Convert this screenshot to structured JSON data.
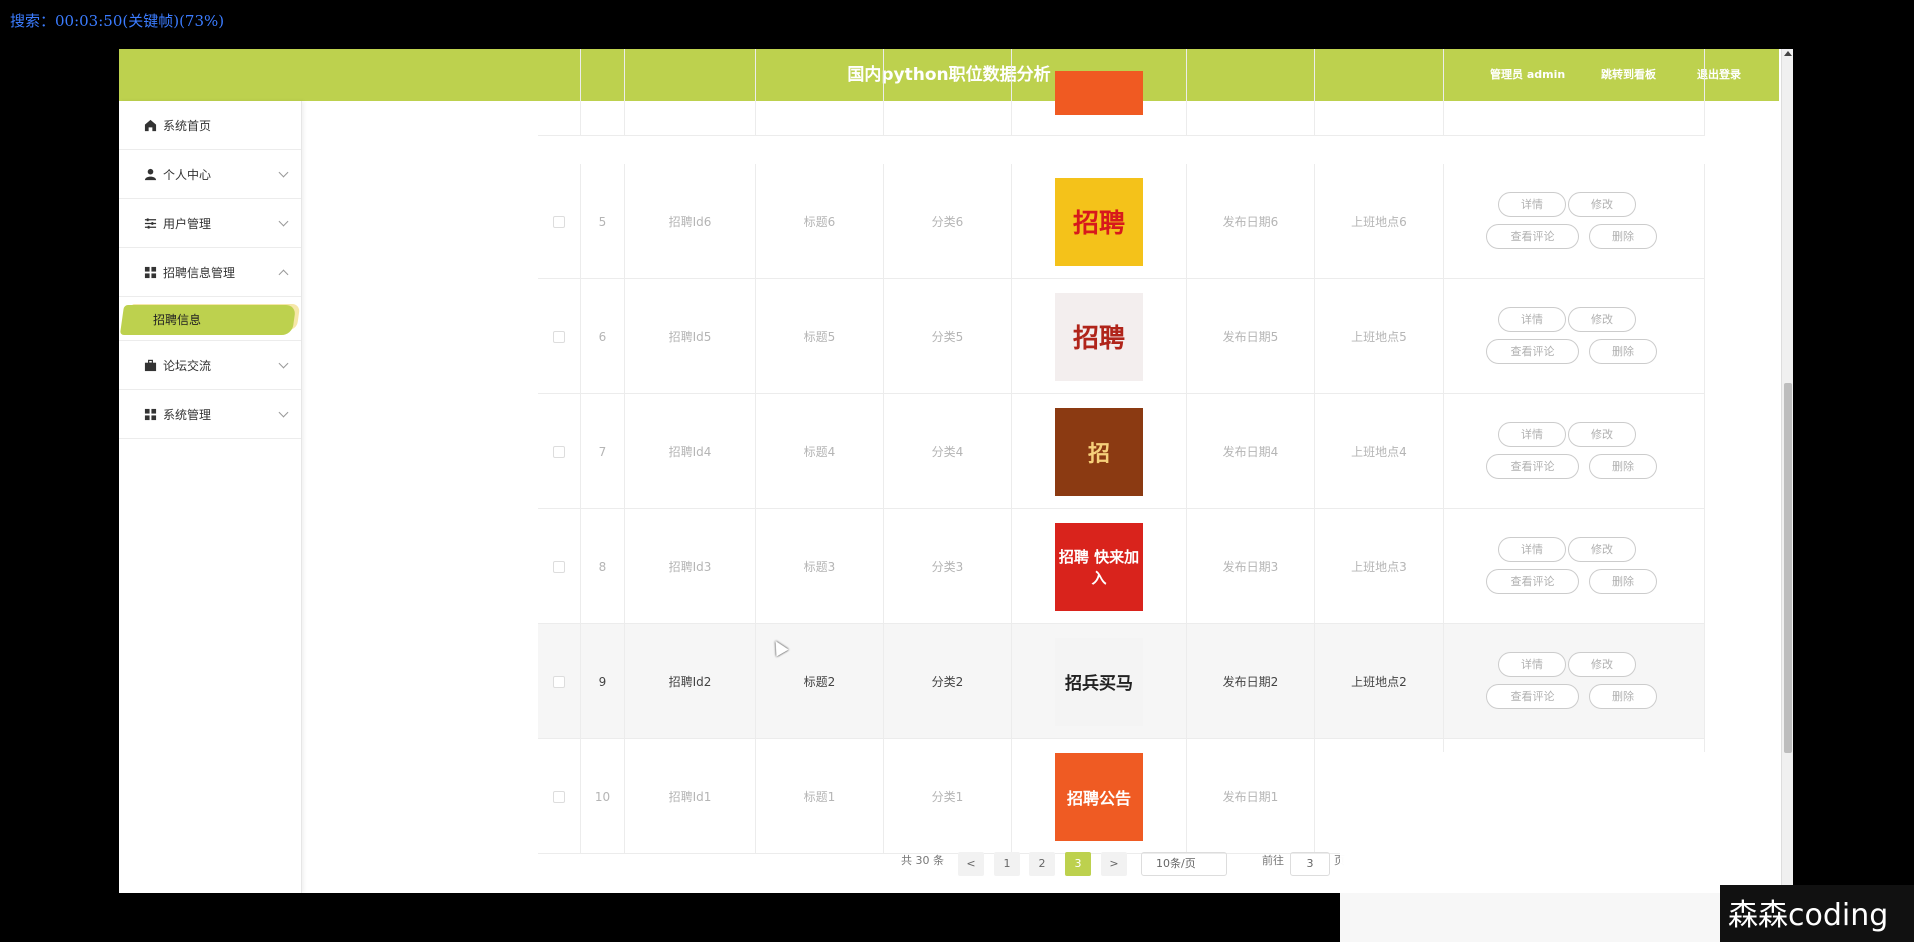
{
  "overlay_top": "搜索：00:03:50(关键帧)(73%)",
  "header": {
    "title": "国内python职位数据分析",
    "nav_admin": "管理员 admin",
    "nav_board": "跳转到看板",
    "nav_logout": "退出登录"
  },
  "sidebar": {
    "items": [
      {
        "label": "系统首页"
      },
      {
        "label": "个人中心"
      },
      {
        "label": "用户管理"
      },
      {
        "label": "招聘信息管理"
      },
      {
        "label": "论坛交流"
      },
      {
        "label": "系统管理"
      }
    ],
    "active_sub": "招聘信息"
  },
  "actions": {
    "detail": "详情",
    "edit": "修改",
    "comments": "查看评论",
    "delete": "删除"
  },
  "rows": [
    {
      "index": "5",
      "id": "招聘Id6",
      "title": "标题6",
      "category": "分类6",
      "date": "发布日期6",
      "place": "上班地点6",
      "img_text": "招聘"
    },
    {
      "index": "6",
      "id": "招聘Id5",
      "title": "标题5",
      "category": "分类5",
      "date": "发布日期5",
      "place": "上班地点5",
      "img_text": "招聘"
    },
    {
      "index": "7",
      "id": "招聘Id4",
      "title": "标题4",
      "category": "分类4",
      "date": "发布日期4",
      "place": "上班地点4",
      "img_text": "招"
    },
    {
      "index": "8",
      "id": "招聘Id3",
      "title": "标题3",
      "category": "分类3",
      "date": "发布日期3",
      "place": "上班地点3",
      "img_text": "招聘 快来加入"
    },
    {
      "index": "9",
      "id": "招聘Id2",
      "title": "标题2",
      "category": "分类2",
      "date": "发布日期2",
      "place": "上班地点2",
      "img_text": "招兵买马"
    },
    {
      "index": "10",
      "id": "招聘Id1",
      "title": "标题1",
      "category": "分类1",
      "date": "发布日期1",
      "place": "",
      "img_text": "招聘公告"
    }
  ],
  "pagination": {
    "total": "共 30 条",
    "prev": "<",
    "next": ">",
    "pages": [
      "1",
      "2",
      "3"
    ],
    "current": "3",
    "page_size": "10条/页",
    "goto_label": "前往",
    "goto_value": "3",
    "goto_suffix": "页"
  },
  "watermark": "森森coding",
  "colors": {
    "accent": "#bdd14e"
  }
}
